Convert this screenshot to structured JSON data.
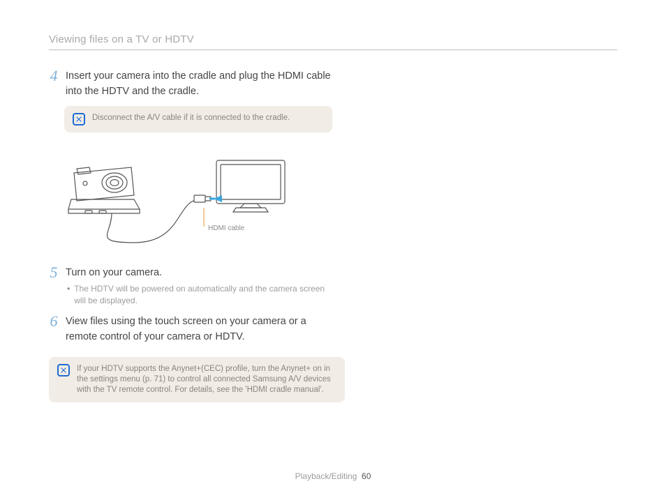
{
  "header": {
    "title": "Viewing files on a TV or HDTV"
  },
  "steps": {
    "s4": {
      "num": "4",
      "text": "Insert your camera into the cradle and plug the HDMI cable into the HDTV and the cradle."
    },
    "s5": {
      "num": "5",
      "text": "Turn on your camera.",
      "sub": "The HDTV will be powered on automatically and the camera screen will be displayed."
    },
    "s6": {
      "num": "6",
      "text": "View files using the touch screen on your camera or a remote control of your camera or HDTV."
    }
  },
  "notes": {
    "disconnect": "Disconnect the A/V cable if it is connected to the cradle.",
    "anynet": "If your HDTV supports the Anynet+(CEC) profile, turn the Anynet+ on in the settings menu (p. 71) to control all connected Samsung A/V devices with the TV remote control. For details, see the 'HDMI cradle manual'."
  },
  "diagram": {
    "label": "HDMI cable"
  },
  "footer": {
    "section": "Playback/Editing",
    "page": "60"
  }
}
